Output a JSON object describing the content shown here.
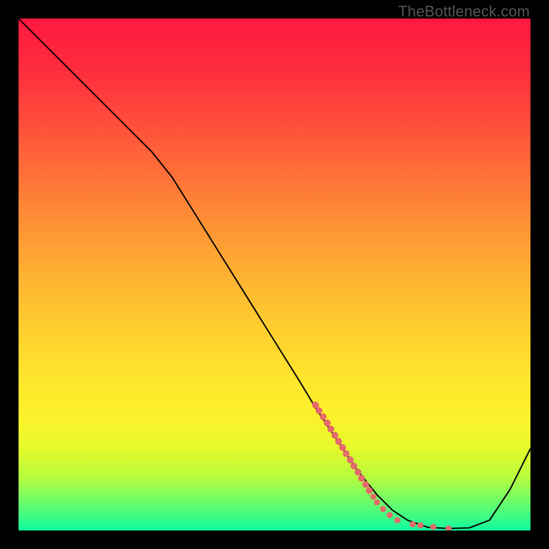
{
  "watermark": "TheBottleneck.com",
  "chart_data": {
    "type": "line",
    "title": "",
    "xlabel": "",
    "ylabel": "",
    "xlim": [
      0,
      100
    ],
    "ylim": [
      0,
      100
    ],
    "grid": false,
    "background_gradient_colors": [
      "#fe1840",
      "#fe2d3e",
      "#fe4c3b",
      "#fe6f38",
      "#fe9135",
      "#feb132",
      "#fecd2f",
      "#fee42d",
      "#fcf22b",
      "#e6fa2a",
      "#b2fc41",
      "#62fc6e",
      "#10fba0"
    ],
    "background_gradient_positions": [
      0,
      10,
      20,
      30,
      40,
      50,
      60,
      70,
      78,
      84,
      90,
      95,
      100
    ],
    "series": [
      {
        "name": "bottleneck-curve",
        "stroke": "#000000",
        "stroke_width": 2,
        "x": [
          0,
          4,
          8,
          12,
          16,
          20,
          23,
          26,
          30,
          35,
          40,
          45,
          50,
          55,
          58,
          62,
          66,
          70,
          73,
          76,
          80,
          84,
          88,
          92,
          96,
          100
        ],
        "y": [
          100,
          96,
          92,
          88,
          84,
          80,
          77,
          74,
          69,
          61,
          53,
          45,
          37,
          29,
          24,
          18,
          12,
          7,
          4,
          2,
          0.6,
          0.4,
          0.5,
          2,
          8,
          16
        ]
      }
    ],
    "markers": {
      "name": "highlight-dots",
      "color": "#e46a6b",
      "points": [
        {
          "x": 58.0,
          "y": 24.5,
          "r": 5
        },
        {
          "x": 58.7,
          "y": 23.4,
          "r": 5
        },
        {
          "x": 59.5,
          "y": 22.2,
          "r": 5
        },
        {
          "x": 60.3,
          "y": 21.0,
          "r": 5
        },
        {
          "x": 61.0,
          "y": 19.8,
          "r": 5
        },
        {
          "x": 61.8,
          "y": 18.6,
          "r": 5
        },
        {
          "x": 62.5,
          "y": 17.4,
          "r": 5
        },
        {
          "x": 63.3,
          "y": 16.2,
          "r": 5
        },
        {
          "x": 64.0,
          "y": 15.0,
          "r": 5
        },
        {
          "x": 64.8,
          "y": 13.8,
          "r": 5
        },
        {
          "x": 65.5,
          "y": 12.6,
          "r": 5
        },
        {
          "x": 66.3,
          "y": 11.4,
          "r": 5
        },
        {
          "x": 67.0,
          "y": 10.2,
          "r": 5
        },
        {
          "x": 67.8,
          "y": 9.0,
          "r": 5
        },
        {
          "x": 68.5,
          "y": 7.8,
          "r": 5
        },
        {
          "x": 69.3,
          "y": 6.6,
          "r": 4.5
        },
        {
          "x": 70.0,
          "y": 5.5,
          "r": 4.5
        },
        {
          "x": 71.2,
          "y": 4.2,
          "r": 4.5
        },
        {
          "x": 72.5,
          "y": 3.0,
          "r": 4.5
        },
        {
          "x": 74.0,
          "y": 2.0,
          "r": 4.5
        },
        {
          "x": 77.0,
          "y": 1.2,
          "r": 4.5
        },
        {
          "x": 78.5,
          "y": 1.0,
          "r": 4.5
        },
        {
          "x": 81.0,
          "y": 0.7,
          "r": 4.5
        },
        {
          "x": 84.0,
          "y": 0.4,
          "r": 4.5
        }
      ]
    }
  }
}
